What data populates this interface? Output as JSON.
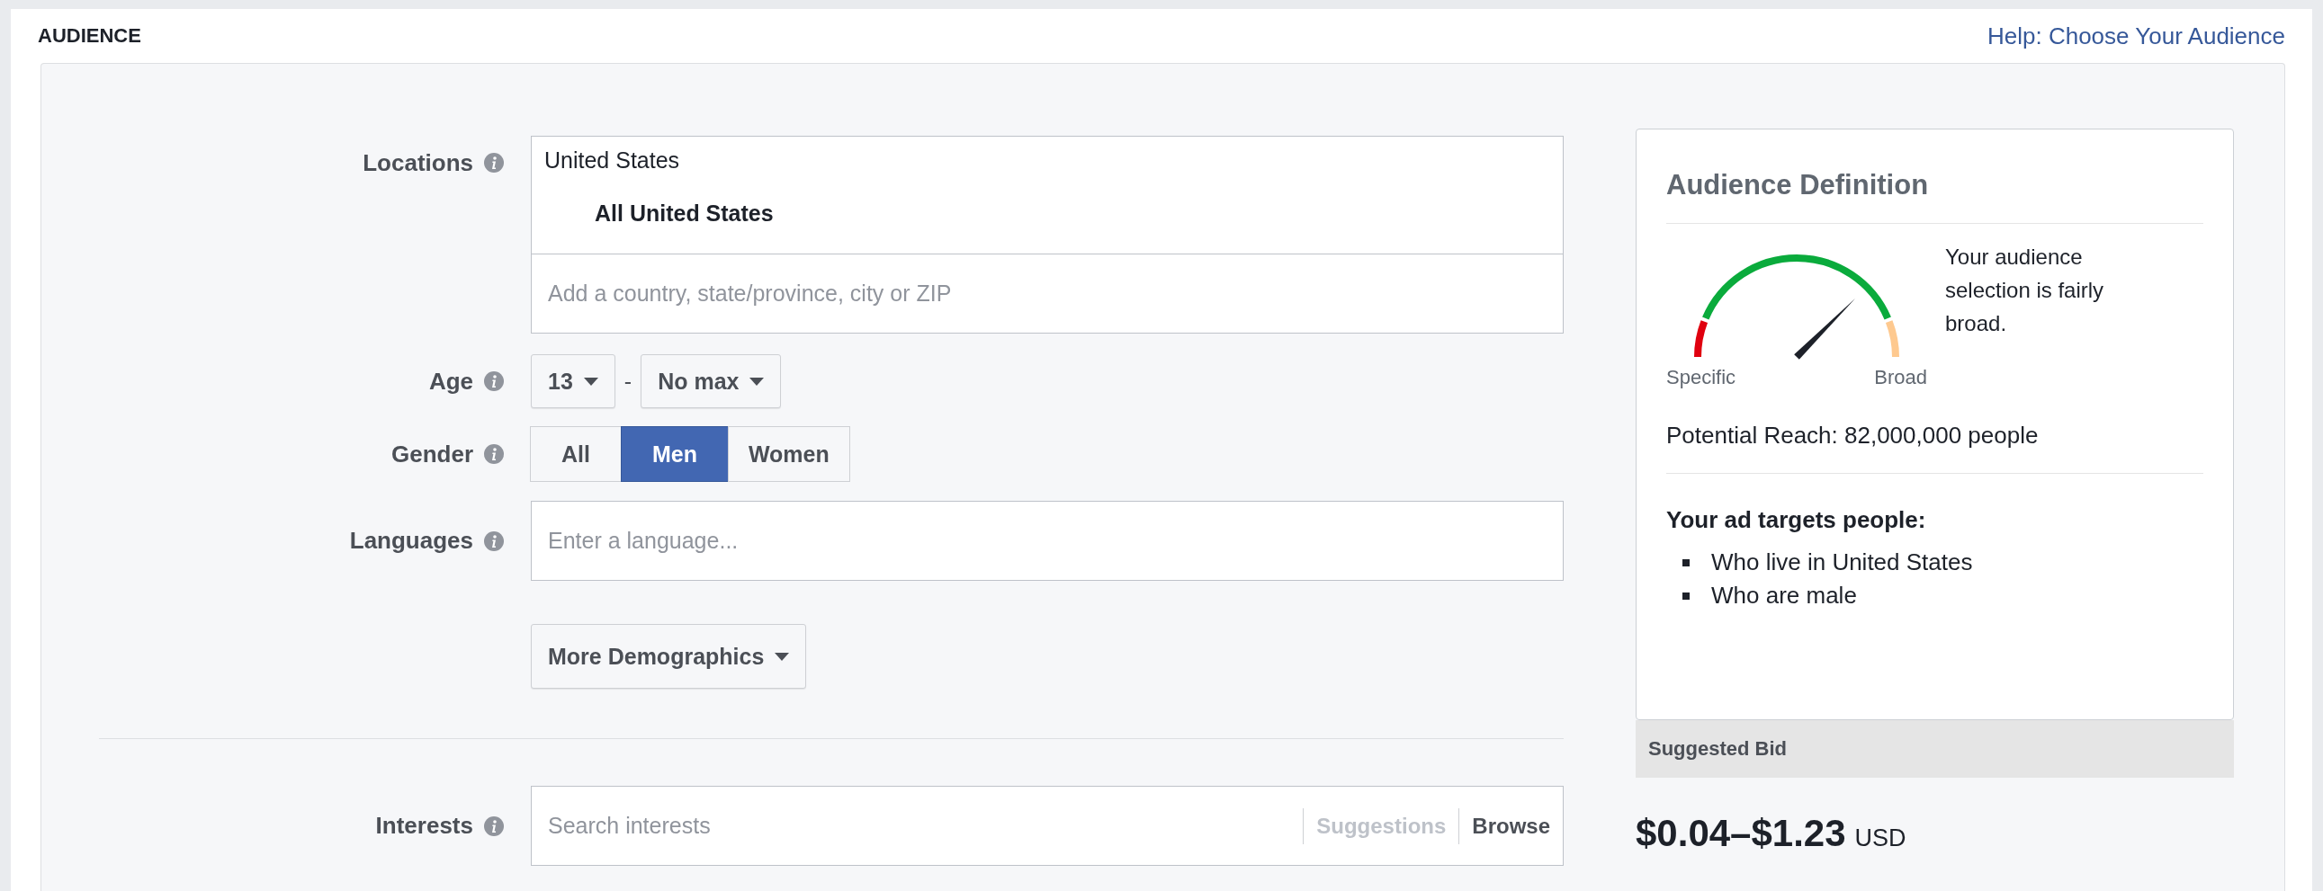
{
  "section_title": "AUDIENCE",
  "help_link": "Help: Choose Your Audience",
  "form": {
    "locations": {
      "label": "Locations",
      "entries": [
        {
          "country": "United States",
          "scope": "All United States"
        }
      ],
      "placeholder": "Add a country, state/province, city or ZIP"
    },
    "age": {
      "label": "Age",
      "min": "13",
      "separator": "-",
      "max": "No max"
    },
    "gender": {
      "label": "Gender",
      "options": [
        {
          "label": "All",
          "selected": false
        },
        {
          "label": "Men",
          "selected": true
        },
        {
          "label": "Women",
          "selected": false
        }
      ]
    },
    "languages": {
      "label": "Languages",
      "placeholder": "Enter a language..."
    },
    "more_button": "More Demographics",
    "interests": {
      "label": "Interests",
      "placeholder": "Search interests",
      "actions": [
        {
          "label": "Suggestions",
          "disabled": true
        },
        {
          "label": "Browse",
          "disabled": false
        }
      ]
    }
  },
  "definition": {
    "title": "Audience Definition",
    "gauge": {
      "min_label": "Specific",
      "max_label": "Broad"
    },
    "summary": "Your audience selection is fairly broad.",
    "reach": "Potential Reach: 82,000,000 people",
    "targets_title": "Your ad targets people:",
    "targets": [
      "Who live in United States",
      "Who are male"
    ]
  },
  "bid": {
    "title": "Suggested Bid",
    "range": "$0.04–$1.23",
    "currency": "USD"
  }
}
